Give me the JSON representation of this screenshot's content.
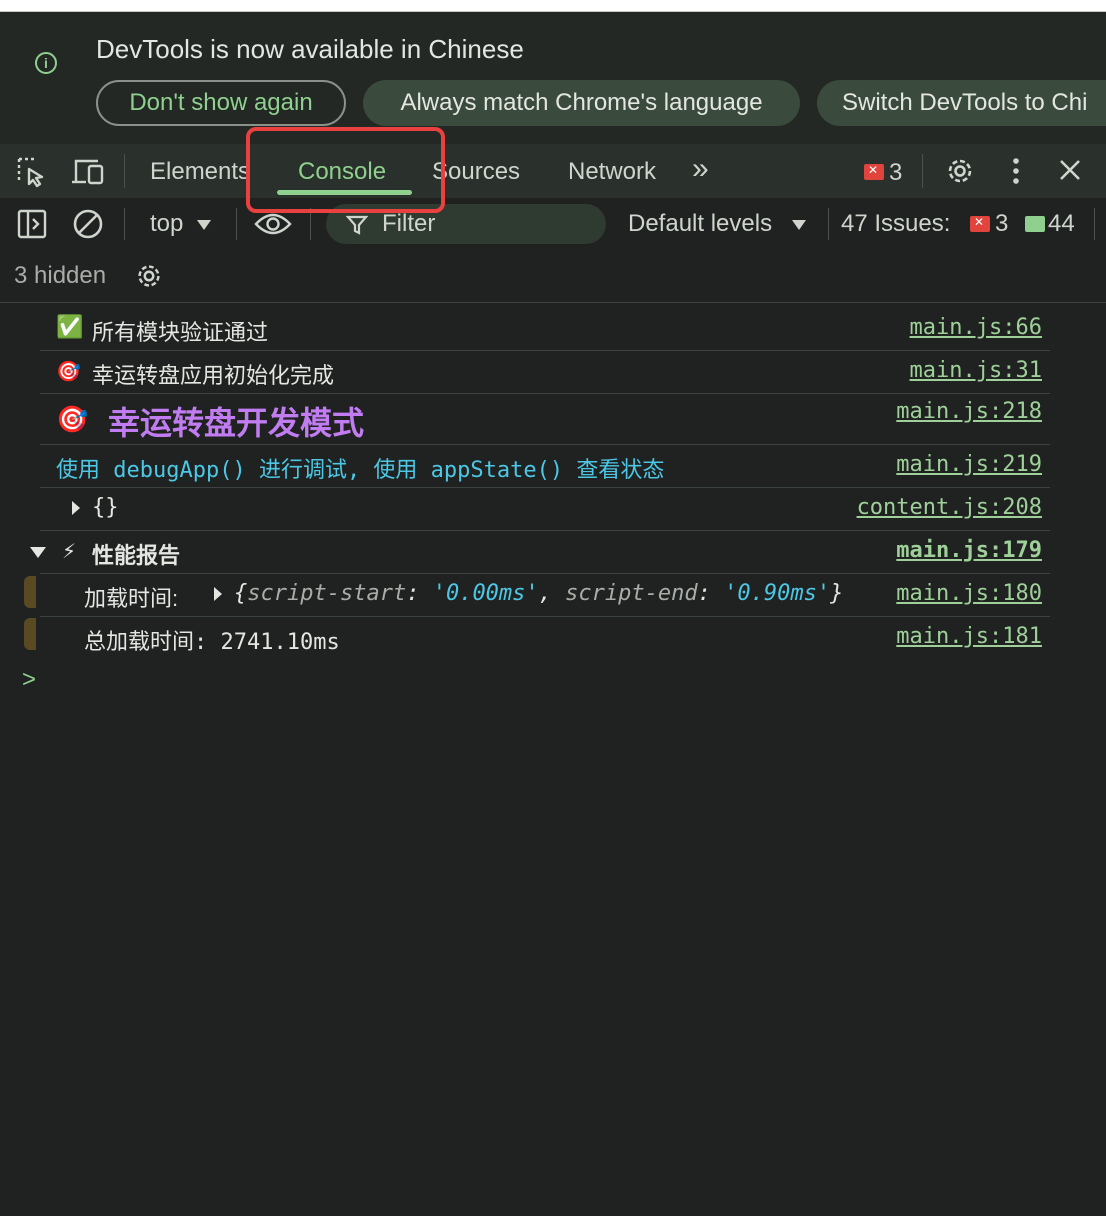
{
  "infobar": {
    "message": "DevTools is now available in Chinese",
    "dont_show": "Don't show again",
    "always_match": "Always match Chrome's language",
    "switch": "Switch DevTools to Chi"
  },
  "tabs": {
    "elements": "Elements",
    "console": "Console",
    "sources": "Sources",
    "network": "Network",
    "more": "»",
    "error_count": "3"
  },
  "toolbar": {
    "context": "top",
    "filter_placeholder": "Filter",
    "levels": "Default levels",
    "issues_label": "47 Issues:",
    "issues_errors": "3",
    "issues_messages": "44",
    "hidden": "3 hidden"
  },
  "colors": {
    "accent": "#8fd08e",
    "error": "#e0443c",
    "purple": "#c07cf0",
    "cyan": "#4cc7e5",
    "highlight": "#e8413f"
  },
  "console": {
    "rows": [
      {
        "icon": "✅",
        "text": "所有模块验证通过",
        "source": "main.js:66"
      },
      {
        "icon": "🎯",
        "text": "幸运转盘应用初始化完成",
        "source": "main.js:31"
      },
      {
        "icon": "🎯",
        "text": "幸运转盘开发模式",
        "source": "main.js:218"
      },
      {
        "text": "使用 debugApp() 进行调试, 使用 appState() 查看状态",
        "source": "main.js:219"
      },
      {
        "text": "{}",
        "source": "content.js:208"
      },
      {
        "icon": "⚡",
        "text": "性能报告",
        "source": "main.js:179"
      },
      {
        "label": "加载时间:",
        "obj_open": "{",
        "k1": "script-start",
        "colon": ":",
        "v1": "'0.00ms'",
        "comma": ",",
        "k2": "script-end",
        "v2": "'0.90ms'",
        "obj_close": "}",
        "source": "main.js:180"
      },
      {
        "text": "总加载时间: 2741.10ms",
        "source": "main.js:181"
      }
    ],
    "prompt": ">"
  }
}
